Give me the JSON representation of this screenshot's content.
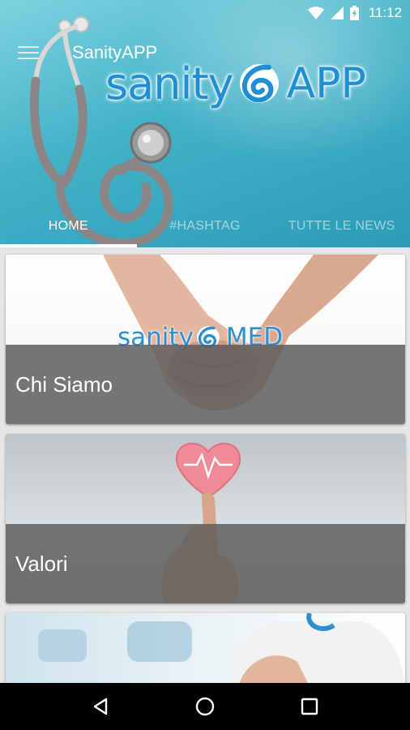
{
  "status_bar": {
    "time": "11:12"
  },
  "app": {
    "title": "SanityAPP"
  },
  "brand": {
    "word": "sanity",
    "suffix": "APP"
  },
  "tabs": [
    {
      "label": "HOME",
      "active": true
    },
    {
      "label": "#HASHTAG",
      "active": false
    },
    {
      "label": "TUTTE LE NEWS",
      "active": false
    }
  ],
  "cards": [
    {
      "title": "Chi Siamo",
      "logo_word": "sanity",
      "logo_suffix": "MED"
    },
    {
      "title": "Valori"
    },
    {
      "title": ""
    }
  ],
  "colors": {
    "hero": "#43b2c8",
    "brand_blue": "#1e8fd2",
    "caption_overlay": "#5c5c5c",
    "navbar": "#000000"
  },
  "icons": {
    "status": [
      "wifi-icon",
      "cell-signal-icon",
      "battery-charging-icon"
    ],
    "toolbar": [
      "hamburger-menu-icon"
    ],
    "navigation": [
      "back-icon",
      "home-icon",
      "recents-icon"
    ]
  }
}
